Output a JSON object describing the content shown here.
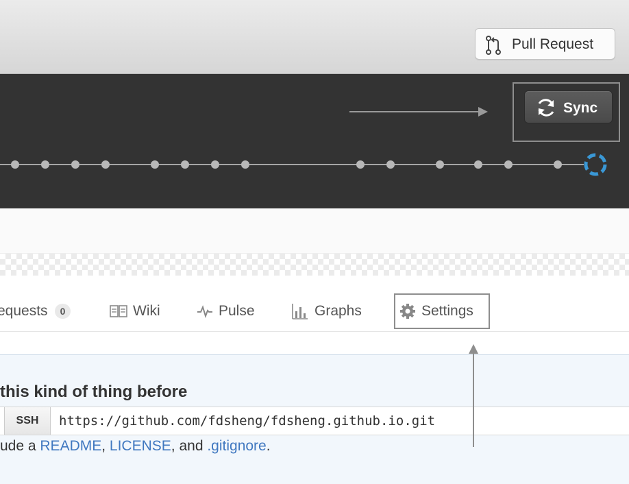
{
  "toolbar": {
    "pull_request_label": "Pull Request"
  },
  "sync": {
    "label": "Sync"
  },
  "tabs": {
    "pull_requests_label": "equests",
    "pull_requests_count": "0",
    "wiki_label": "Wiki",
    "pulse_label": "Pulse",
    "graphs_label": "Graphs",
    "settings_label": "Settings"
  },
  "quick_setup": {
    "heading": "this kind of thing before",
    "ssh_label": "SSH",
    "clone_url": "https://github.com/fdsheng/fdsheng.github.io.git",
    "hint_prefix": "ude a ",
    "readme_link": "README",
    "sep1": ", ",
    "license_link": "LICENSE",
    "sep2": ", and ",
    "gitignore_link": ".gitignore",
    "hint_suffix": "."
  },
  "colors": {
    "dark_band": "#333333",
    "sync_spinner": "#3a98d6",
    "link": "#4078c0",
    "panel_bg": "#f2f7fc"
  },
  "icons": [
    "pull-request-icon",
    "sync-icon",
    "book-icon",
    "pulse-icon",
    "graph-icon",
    "gear-icon",
    "spinner-icon"
  ]
}
